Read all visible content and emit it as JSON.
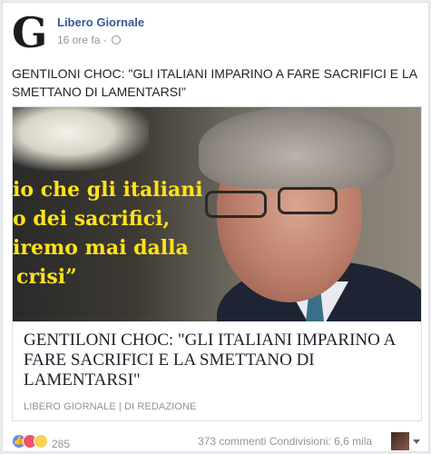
{
  "post": {
    "page_name": "Libero Giornale",
    "logo_letter": "G",
    "timestamp": "16 ore fa",
    "separator": "·",
    "privacy_icon": "globe-icon",
    "text": "GENTILONI CHOC: \"GLI ITALIANI IMPARINO A FARE SACRIFICI E LA SMETTANO DI LAMENTARSI\""
  },
  "link_card": {
    "image_quote_lines": [
      "io che gli italiani",
      "o dei sacrifici,",
      "iremo mai dalla",
      "crisi”"
    ],
    "title": "GENTILONI CHOC: \"GLI ITALIANI IMPARINO A FARE SACRIFICI E LA SMETTANO DI LAMENTARSI\"",
    "source": "LIBERO GIORNALE",
    "source_separator": "|",
    "author": "DI REDAZIONE"
  },
  "footer": {
    "reaction_icons": [
      "like-icon",
      "angry-icon",
      "haha-icon"
    ],
    "reaction_count": "285",
    "comments": "373 commenti",
    "shares": "Condivisioni: 6,6 mila"
  },
  "colors": {
    "page_link": "#365899",
    "quote_yellow": "#ffe21a",
    "meta_gray": "#90949c",
    "like_blue": "#5890ff"
  }
}
